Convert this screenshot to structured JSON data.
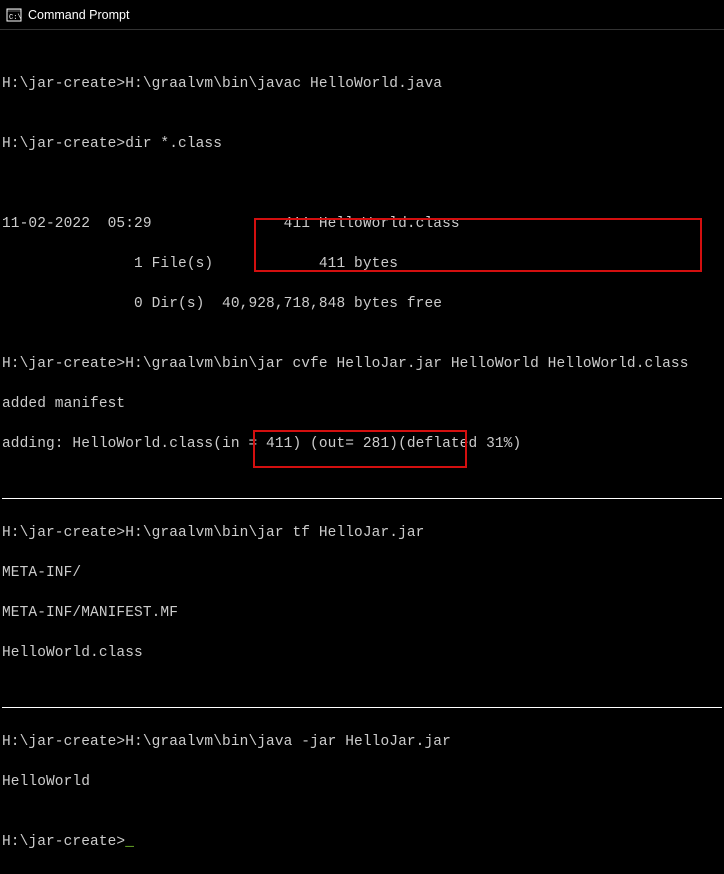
{
  "window": {
    "title": "Command Prompt"
  },
  "lines": {
    "l1a": "H:\\jar-create>H:\\graalvm\\bin\\javac HelloWorld.java",
    "blank": "",
    "l2a": "H:\\jar-create>dir *.class",
    "l3a": "11-02-2022  05:29               411 HelloWorld.class",
    "l3b": "               1 File(s)            411 bytes",
    "l3c": "               0 Dir(s)  40,928,718,848 bytes free",
    "l4a": "H:\\jar-create>H:\\graalvm\\bin\\jar cvfe HelloJar.jar HelloWorld HelloWorld.class",
    "l4b": "added manifest",
    "l4c": "adding: HelloWorld.class(in = 411) (out= 281)(deflated 31%)",
    "l5a": "H:\\jar-create>H:\\graalvm\\bin\\jar tf HelloJar.jar",
    "l5b": "META-INF/",
    "l5c": "META-INF/MANIFEST.MF",
    "l5d": "HelloWorld.class",
    "l6a": "H:\\jar-create>H:\\graalvm\\bin\\java -jar HelloJar.jar",
    "l6b": "HelloWorld",
    "l7a": "H:\\jar-create>"
  }
}
